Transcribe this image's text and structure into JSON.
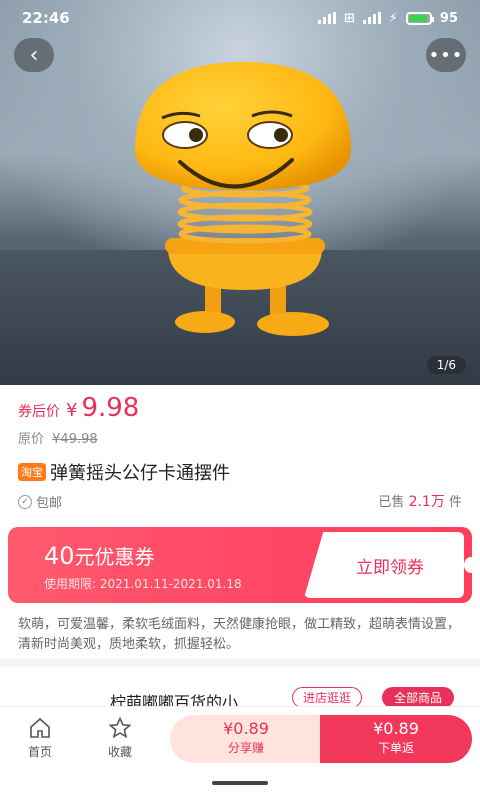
{
  "status_bar": {
    "time": "22:46",
    "battery": "95"
  },
  "gallery": {
    "counter": "1/6"
  },
  "price": {
    "after_coupon_label": "券后价",
    "currency": "¥",
    "after_coupon_value": "9.98",
    "original_label": "原价",
    "original_value": "¥49.98"
  },
  "product": {
    "platform_badge": "淘宝",
    "title": "弹簧摇头公仔卡通摆件",
    "shipping": "包邮",
    "sold_prefix": "已售",
    "sold_count": "2.1万",
    "sold_suffix": "件"
  },
  "coupon": {
    "amount": "40",
    "amount_suffix": "元优惠券",
    "period_label": "使用期限:",
    "period": "2021.01.11-2021.01.18",
    "claim_label": "立即领券"
  },
  "description": "软萌，可爱温馨，柔软毛绒面料，天然健康抢眼，做工精致，超萌表情设置，清新时尚美观，质地柔软，抓握轻松。",
  "shop": {
    "name": "柠萌嘟嘟百货的小...",
    "visit_label": "进店逛逛",
    "all_label": "全部商品"
  },
  "bottom_bar": {
    "home_label": "首页",
    "fav_label": "收藏",
    "share_price": "¥0.89",
    "share_label": "分享赚",
    "buy_price": "¥0.89",
    "buy_label": "下单返"
  },
  "colors": {
    "accent": "#e8315a",
    "badge": "#ff7b1a"
  }
}
